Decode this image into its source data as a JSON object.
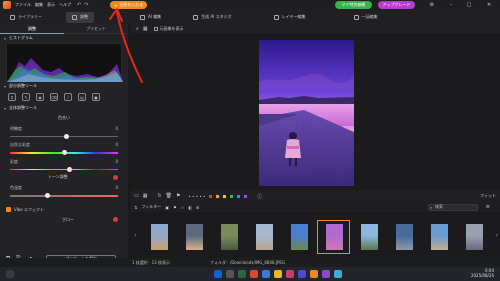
{
  "menubar": {
    "menus": [
      "ファイル",
      "編集",
      "表示",
      "ヘルプ"
    ],
    "annotate_label": "注釈を入れる",
    "upgrade_label": "マイ特別価格",
    "pro_label": "アップグレード"
  },
  "modes": [
    {
      "label": "ライブラリー"
    },
    {
      "label": "調整"
    },
    {
      "label": "AI 編集"
    },
    {
      "label": "生成 AI スタジオ"
    },
    {
      "label": "レイヤー編集"
    },
    {
      "label": "一括編集"
    }
  ],
  "leftpanel": {
    "tabs": [
      "調整",
      "プリセット"
    ],
    "histogram_title": "ヒストグラム",
    "local_tools_title": "部分調整ツール",
    "global_tools_title": "全体調整ツール",
    "tone_group": "色合い",
    "sliders": [
      {
        "label": "明瞭度",
        "value": 0,
        "pos": 0.52
      },
      {
        "label": "自然な彩度",
        "value": 0,
        "pos": 0.5
      },
      {
        "label": "彩度",
        "value": 0,
        "pos": 0.55
      },
      {
        "label": "色温度",
        "value": 0,
        "pos": 0.35
      }
    ],
    "tone_curve_label": "トーン調整",
    "ai_section_label": "Vibe エフェクト",
    "glow_label": "グロー",
    "save_preset_label": "プリセットを保存"
  },
  "viewbar": {
    "compare_label": "元画像を表示"
  },
  "filmbar": {
    "colors": [
      "#e2383a",
      "#f0a02a",
      "#e8d23a",
      "#3fb94b",
      "#3a8ef0",
      "#9a4ce0",
      "#aaaaaa"
    ],
    "fit_label": "フィット",
    "filter_label": "フィルター",
    "search_placeholder": "検索"
  },
  "filmstrip": {
    "thumbs": [
      {
        "c1": "#8fa7c9",
        "c2": "#c9a06a",
        "selected": false
      },
      {
        "c1": "#5b6a7e",
        "c2": "#d6b28d",
        "selected": false
      },
      {
        "c1": "#7a8a5a",
        "c2": "#4a5a3a",
        "selected": false
      },
      {
        "c1": "#a5b8d0",
        "c2": "#b9a38a",
        "selected": false
      },
      {
        "c1": "#4a7fd0",
        "c2": "#6a8a4a",
        "selected": false
      },
      {
        "c1": "#b06ad0",
        "c2": "#d07ab0",
        "selected": true
      },
      {
        "c1": "#8ab6e0",
        "c2": "#5a7a4a",
        "selected": false
      },
      {
        "c1": "#4a6a9a",
        "c2": "#8a9aaa",
        "selected": false
      },
      {
        "c1": "#6a9ad0",
        "c2": "#c0b090",
        "selected": false
      },
      {
        "c1": "#9aa0b0",
        "c2": "#6a6a7a",
        "selected": false
      }
    ]
  },
  "status": {
    "selection": "1 枚選択 · 13 枚表示",
    "path": "フォルダ：/Downloads/IMG_8808.JPEG",
    "time": "0:04",
    "date": "2025/08/26"
  },
  "colors": {
    "accent": "#f08a1c",
    "upgrade": "#36b34a",
    "pro": "#b63dd1",
    "arrow": "#e0281c"
  }
}
